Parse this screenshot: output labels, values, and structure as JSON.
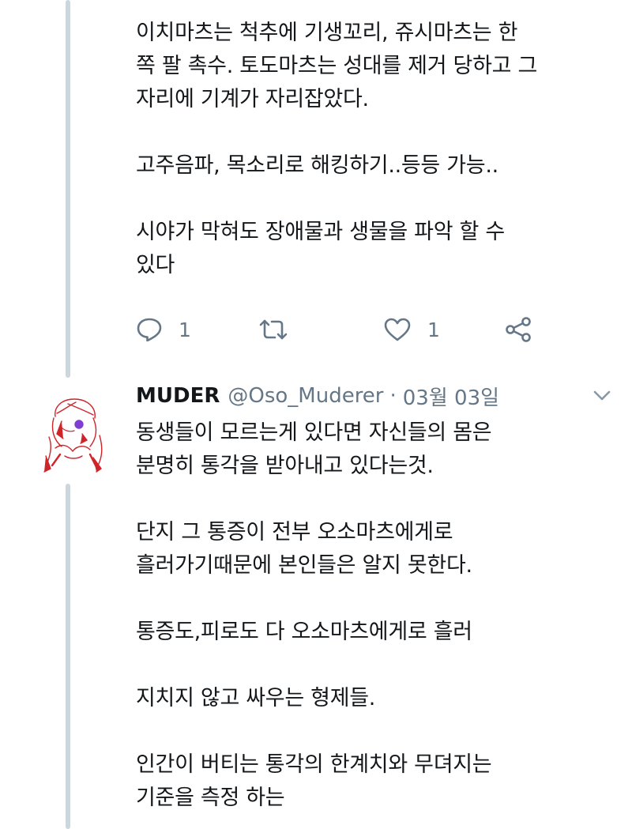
{
  "tweet1": {
    "text_lines": [
      "이치마츠는 척추에 기생꼬리, 쥬시마츠는 한",
      "쪽 팔 촉수. 토도마츠는 성대를 제거 당하고 그",
      "자리에 기계가 자리잡았다.",
      "",
      "고주음파, 목소리로 해킹하기..등등 가능..",
      "",
      "시야가 막혀도 장애물과 생물을 파악 할 수",
      "있다"
    ],
    "actions": {
      "reply_icon": "reply-icon",
      "reply_count": "1",
      "retweet_icon": "retweet-icon",
      "like_icon": "heart-icon",
      "like_count": "1",
      "share_icon": "share-icon"
    }
  },
  "tweet2": {
    "author_name": "MUDER",
    "author_handle": "@Oso_Muderer",
    "separator": "·",
    "date": "03월 03일",
    "text_lines": [
      "동생들이 모르는게 있다면 자신들의 몸은",
      "분명히 통각을 받아내고 있다는것.",
      "",
      "단지 그 통증이 전부 오소마츠에게로",
      "흘러가기때문에 본인들은 알지 못한다.",
      "",
      "통증도,피로도 다 오소마츠에게로 흘러",
      "",
      "지치지 않고 싸우는 형제들.",
      "",
      "인간이 버티는 통각의 한계치와 무뎌지는",
      "기준을 측정 하는"
    ]
  },
  "colors": {
    "text": "#14171a",
    "muted": "#657786",
    "thread_line": "#ccd6dd",
    "avatar_accent": "#d0242b"
  }
}
